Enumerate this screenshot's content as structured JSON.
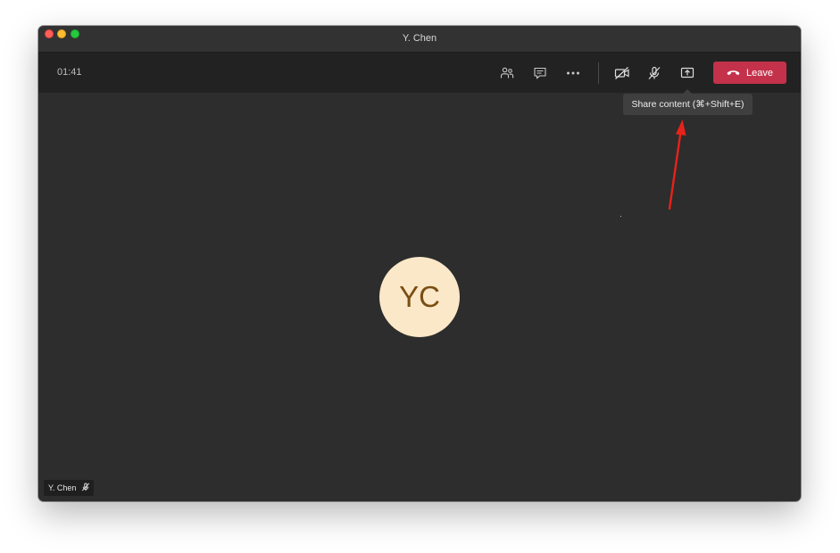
{
  "window": {
    "title": "Y. Chen"
  },
  "toolbar": {
    "timer": "01:41",
    "buttons": [
      {
        "name": "participants",
        "icon": "people-icon"
      },
      {
        "name": "chat",
        "icon": "chat-icon"
      },
      {
        "name": "more",
        "icon": "more-dots-icon"
      },
      {
        "name": "camera",
        "icon": "camera-off-icon"
      },
      {
        "name": "microphone",
        "icon": "mic-off-icon"
      },
      {
        "name": "share",
        "icon": "share-screen-icon"
      }
    ],
    "leave_label": "Leave",
    "leave_color": "#c4314b"
  },
  "tooltip": {
    "text": "Share content (⌘+Shift+E)"
  },
  "stage": {
    "avatar_initials": "YC",
    "avatar_bg": "#fbe8c8",
    "avatar_fg": "#7a4e12",
    "background": "#2d2d2d"
  },
  "participant_tag": {
    "name": "Y. Chen",
    "icon": "mic-off-icon"
  },
  "annotation": {
    "arrow_color": "#e8221b"
  }
}
